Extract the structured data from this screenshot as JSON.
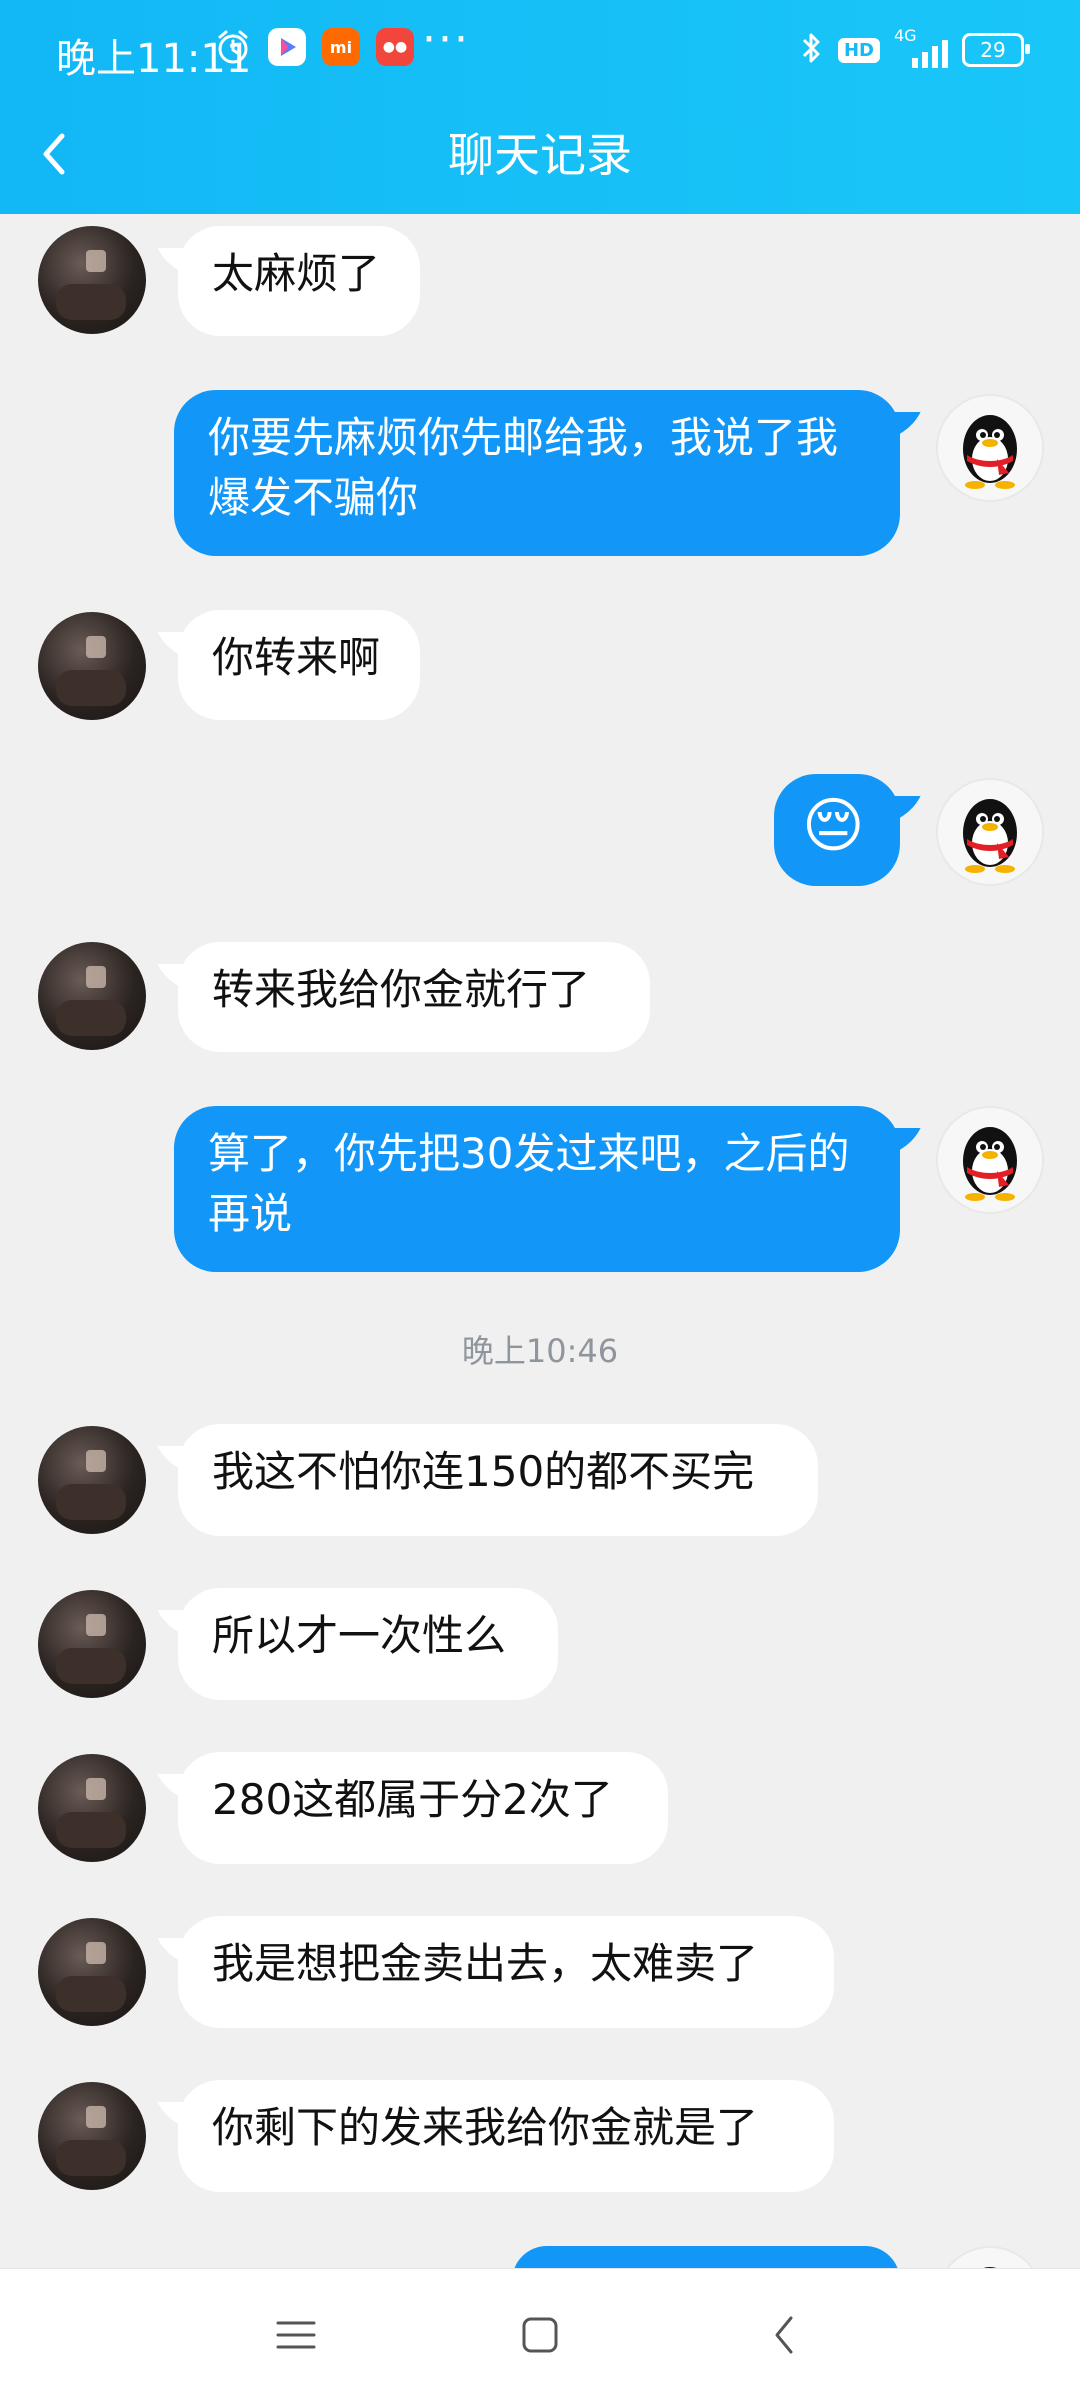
{
  "status_bar": {
    "time": "晚上11:11",
    "icons": [
      "alarm-icon",
      "video-app-icon",
      "mi-store-icon",
      "red-app-icon"
    ],
    "more": "···",
    "right_icons": [
      "bluetooth-icon",
      "hd-icon",
      "signal-icon"
    ],
    "hd_label": "HD",
    "network": "4G",
    "battery": "29"
  },
  "header": {
    "title": "聊天记录"
  },
  "messages": [
    {
      "side": "in",
      "text": "太麻烦了"
    },
    {
      "side": "out",
      "text": "你要先麻烦你先邮给我，我说了我爆发不骗你"
    },
    {
      "side": "in",
      "text": "你转来啊"
    },
    {
      "side": "out",
      "text": "😔",
      "is_emoji": true
    },
    {
      "side": "in",
      "text": "转来我给你金就行了"
    },
    {
      "side": "out",
      "text": "算了，你先把30发过来吧，之后的再说"
    },
    {
      "side": "in",
      "text": "我这不怕你连150的都不买完"
    },
    {
      "side": "in",
      "text": "所以才一次性么"
    },
    {
      "side": "in",
      "text": "280这都属于分2次了"
    },
    {
      "side": "in",
      "text": "我是想把金卖出去，太难卖了"
    },
    {
      "side": "in",
      "text": "你剩下的发来我给你金就是了"
    }
  ],
  "timestamp": "晚上10:46",
  "nav": {
    "menu": "menu-icon",
    "home": "home-icon",
    "back": "back-icon"
  },
  "colors": {
    "header_start": "#12b7f5",
    "header_end": "#19c6f8",
    "outgoing_bubble": "#1297f8",
    "incoming_bubble": "#ffffff",
    "background": "#f0f0f0"
  }
}
